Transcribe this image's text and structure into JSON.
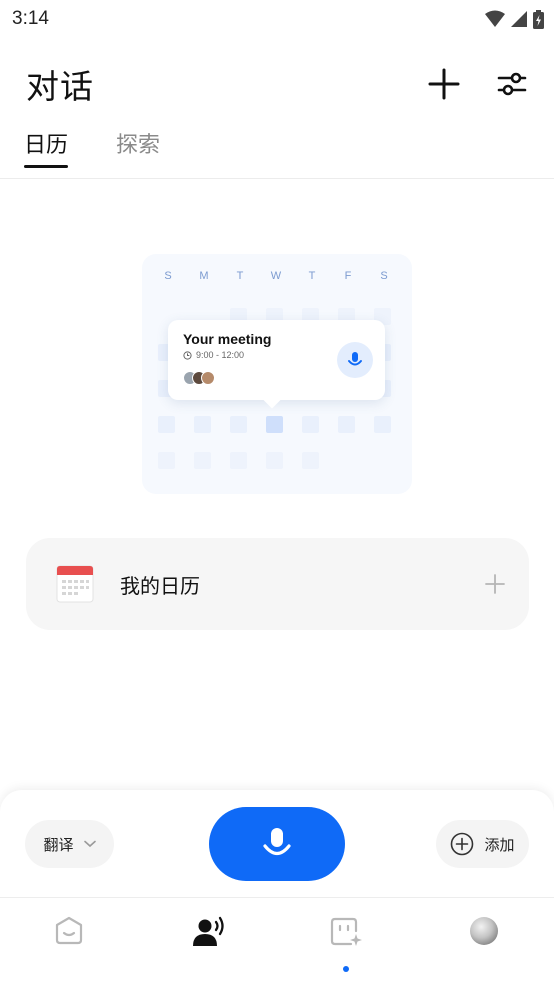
{
  "status_bar": {
    "time": "3:14"
  },
  "header": {
    "title": "对话"
  },
  "tabs": [
    {
      "label": "日历",
      "active": true
    },
    {
      "label": "探索",
      "active": false
    }
  ],
  "illustration": {
    "weekdays": [
      "S",
      "M",
      "T",
      "W",
      "T",
      "F",
      "S"
    ],
    "meeting": {
      "title": "Your meeting",
      "time": "9:00 - 12:00"
    }
  },
  "calendar": {
    "label": "我的日历"
  },
  "bottom": {
    "translate_label": "翻译",
    "add_label": "添加"
  },
  "colors": {
    "accent": "#0f6af7",
    "calendar_red": "#e84f4f"
  },
  "nav": {
    "items": [
      {
        "icon": "assistant-face-icon"
      },
      {
        "icon": "voice-person-icon",
        "active": true
      },
      {
        "icon": "ai-note-icon",
        "has_dot": true
      },
      {
        "icon": "profile-avatar-icon"
      }
    ]
  }
}
